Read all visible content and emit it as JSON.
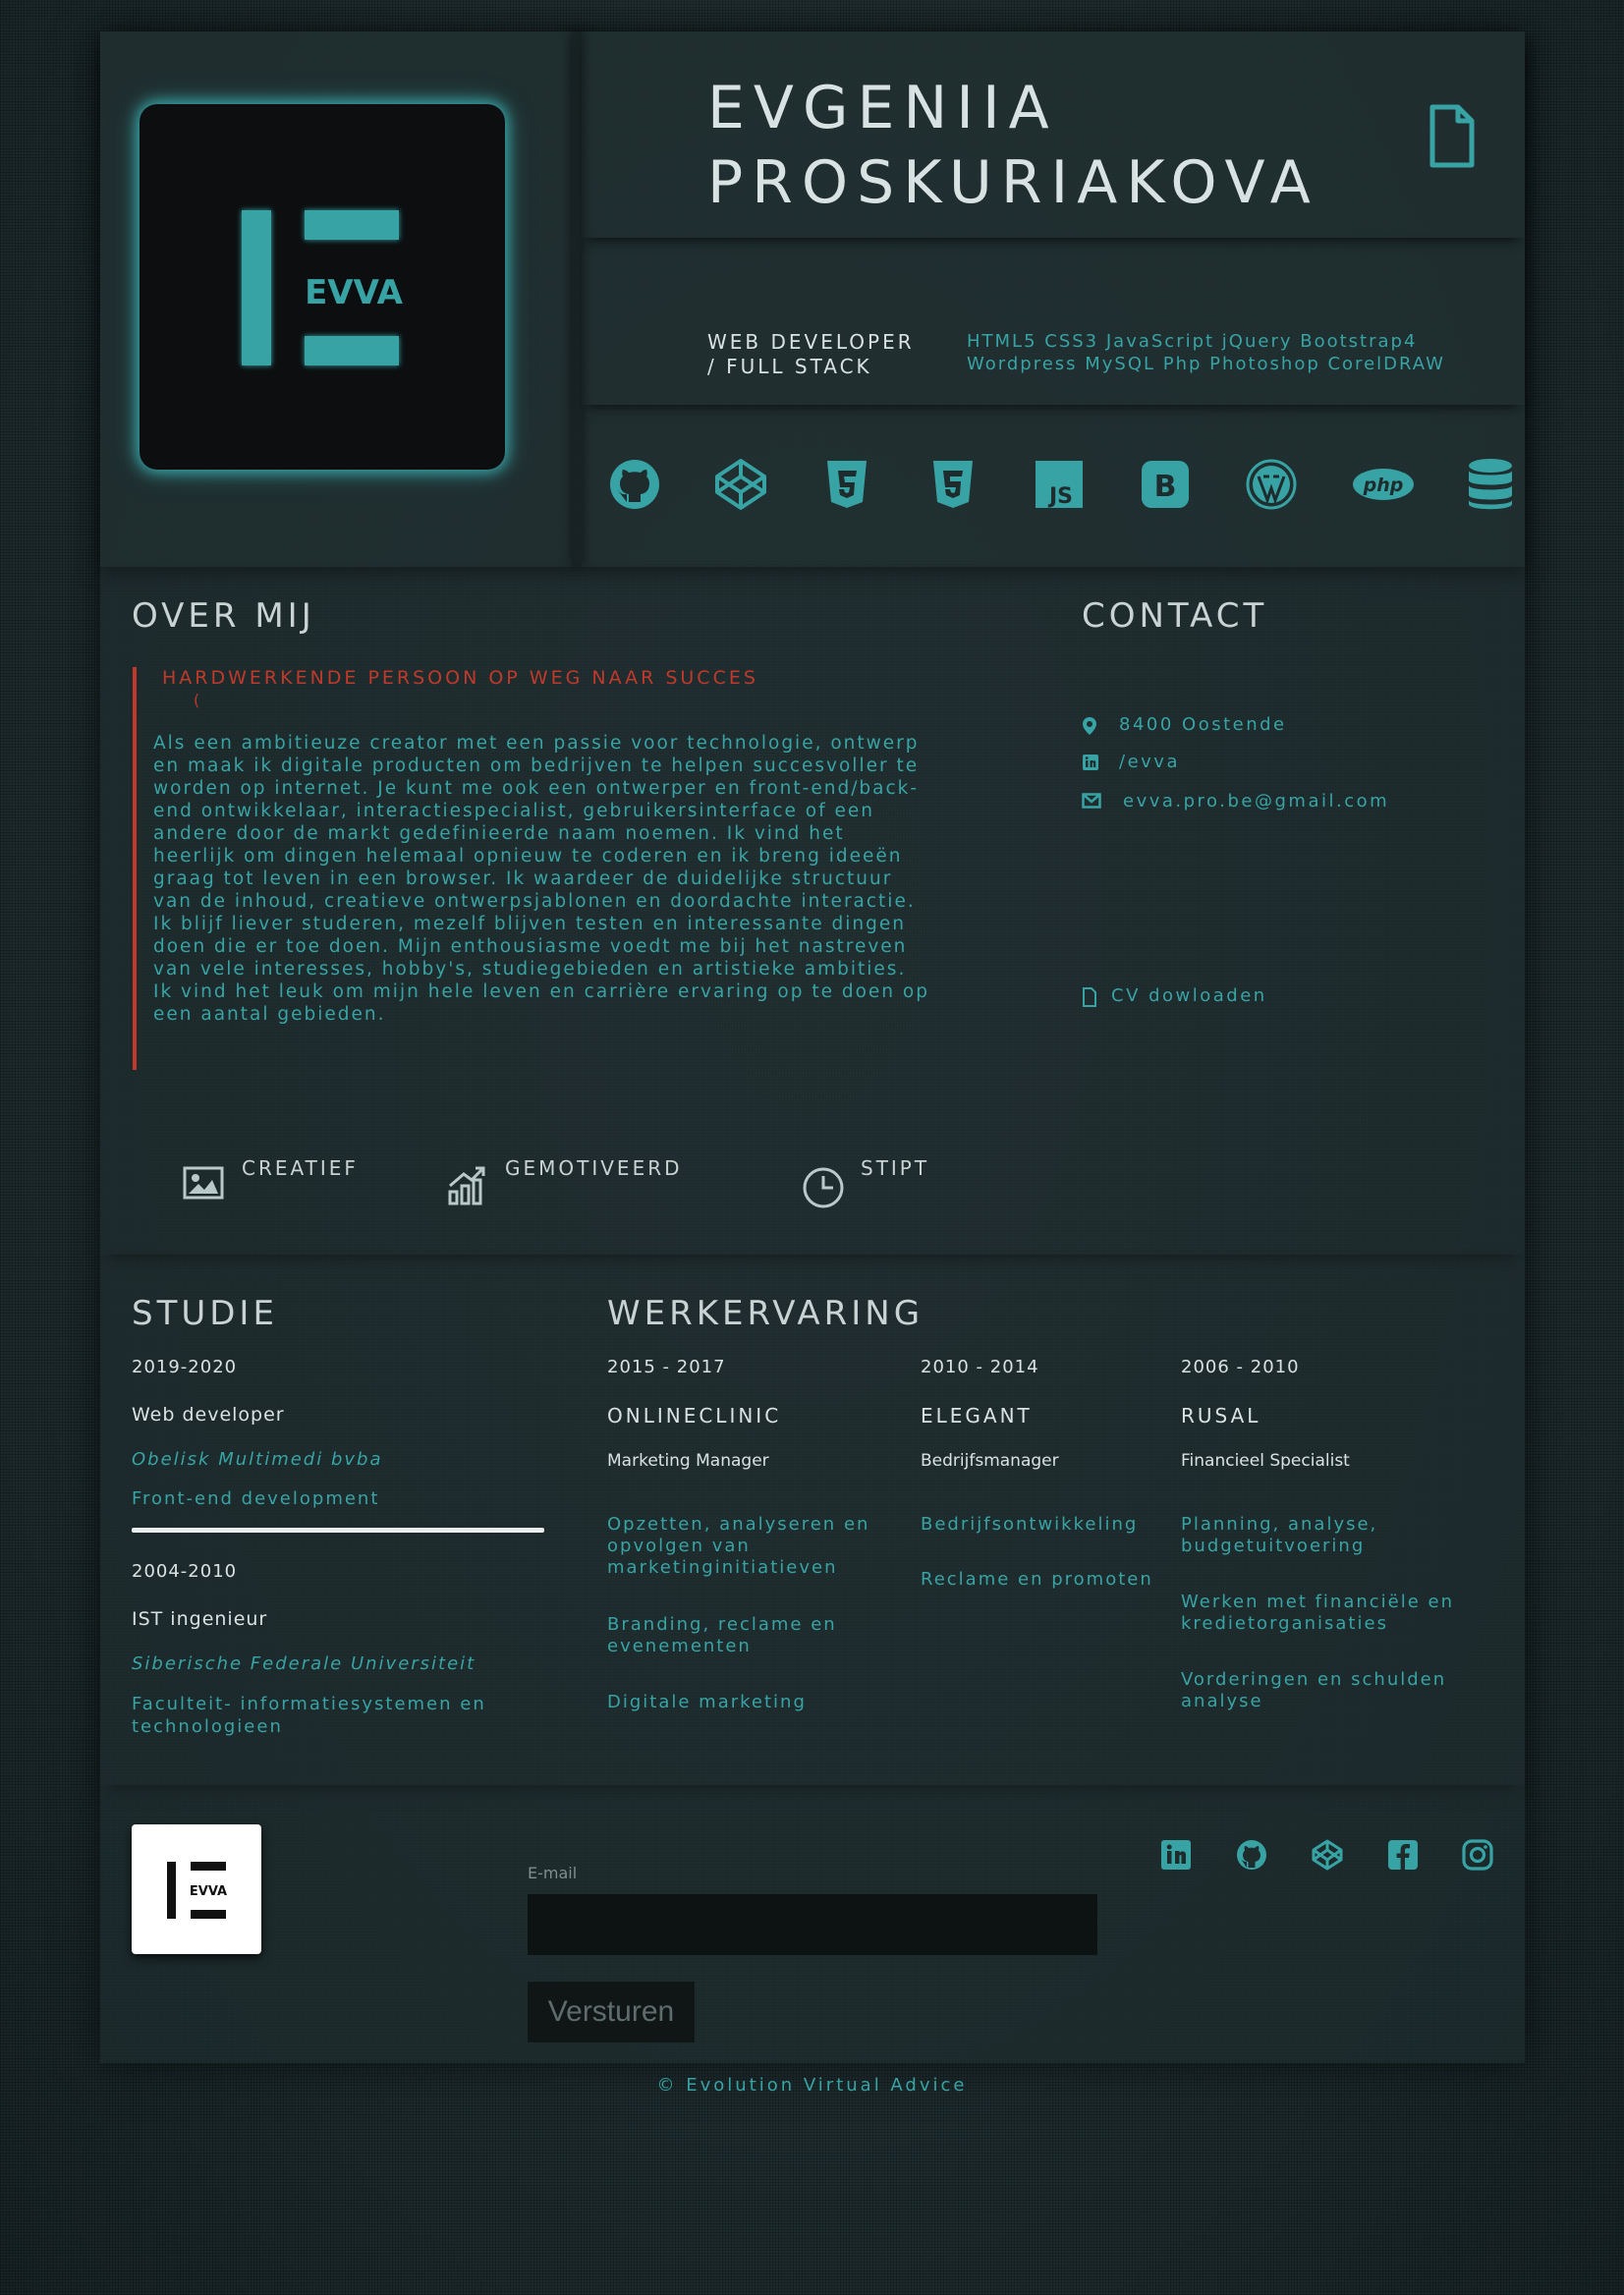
{
  "colors": {
    "accent": "#38a3a5",
    "highlight": "#c0392b",
    "glow": "#40c6c8"
  },
  "header": {
    "name_line1": "EVGENIIA",
    "name_line2": "PROSKURIAKOVA",
    "logo_text": "EVVA",
    "role_line1": "WEB DEVELOPER",
    "role_line2": "/ FULL STACK",
    "skills_line1": "HTML5 CSS3 JavaScript jQuery Bootstrap4",
    "skills_line2": "Wordpress MySQL Php Photoshop CorelDRAW",
    "doc_icon": "file-icon",
    "tech_icons": [
      "github-icon",
      "codepen-icon",
      "html5-icon",
      "css3-icon",
      "js-icon",
      "bootstrap-icon",
      "wordpress-icon",
      "php-icon",
      "database-icon"
    ],
    "php_text": "php",
    "js_text": "JS",
    "bootstrap_text": "B"
  },
  "about": {
    "heading": "OVER MIJ",
    "tagline": "HARDWERKENDE PERSOON OP WEG NAAR SUCCES",
    "tagline_sub": "(",
    "text": "Als een ambitieuze creator met een passie voor technologie, ontwerp en maak ik digitale producten om bedrijven te helpen succesvoller te worden op internet. Je kunt me ook een ontwerper en front-end/back-end ontwikkelaar, interactiespecialist, gebruikersinterface of een andere door de markt gedefinieerde naam noemen. Ik vind het heerlijk om dingen helemaal opnieuw te coderen en ik breng ideeën graag tot leven in een browser. Ik waardeer de duidelijke structuur van de inhoud, creatieve ontwerpsjablonen en doordachte interactie.",
    "text2": "Ik blijf liever studeren, mezelf blijven testen en interessante dingen doen die er toe doen. Mijn enthousiasme voedt me bij het nastreven van vele interesses, hobby's, studiegebieden en artistieke ambities. Ik vind het leuk om mijn hele leven en carrière ervaring op te doen op een aantal gebieden.",
    "traits": [
      "CREATIEF",
      "GEMOTIVEERD",
      "STIPT"
    ]
  },
  "contact": {
    "heading": "CONTACT",
    "location": "8400 Oostende",
    "linkedin": "/evva",
    "email": "evva.pro.be@gmail.com",
    "cv_link": "CV dowloaden"
  },
  "studies": {
    "heading": "STUDIE",
    "items": [
      {
        "date": "2019-2020",
        "title": "Web developer",
        "school": "Obelisk Multimedi bvba",
        "field": "Front-end development"
      },
      {
        "date": "2004-2010",
        "title": "IST ingenieur",
        "school": "Siberische Federale Universiteit",
        "field1": "Faculteit- informatiesystemen en",
        "field2": "technologieen"
      }
    ]
  },
  "work": {
    "heading": "WERKERVARING",
    "jobs": [
      {
        "date": "2015 - 2017",
        "company": "ONLINECLINIC",
        "role": "Marketing Manager",
        "t1a": "Opzetten, analyseren en",
        "t1b": "opvolgen van",
        "t1c": "marketinginitiatieven",
        "t2a": "Branding, reclame en",
        "t2b": "evenementen",
        "t3": "Digitale marketing"
      },
      {
        "date": "2010 - 2014",
        "company": "ELEGANT",
        "role": "Bedrijfsmanager",
        "t1": "Bedrijfsontwikkeling",
        "t2": "Reclame en promoten"
      },
      {
        "date": "2006 - 2010",
        "company": "RUSAL",
        "role": "Financieel Specialist",
        "t1a": "Planning, analyse,",
        "t1b": "budgetuitvoering",
        "t2a": "Werken met financiële en",
        "t2b": "kredietorganisaties",
        "t3a": "Vorderingen en schulden",
        "t3b": "analyse"
      }
    ]
  },
  "footer": {
    "logo_text": "EVVA",
    "email_label": "E-mail",
    "email_value": "",
    "send_label": "Versturen",
    "social": [
      "linkedin-icon",
      "github-icon",
      "codepen-icon",
      "facebook-icon",
      "instagram-icon"
    ],
    "copyright": "© Evolution Virtual Advice"
  }
}
